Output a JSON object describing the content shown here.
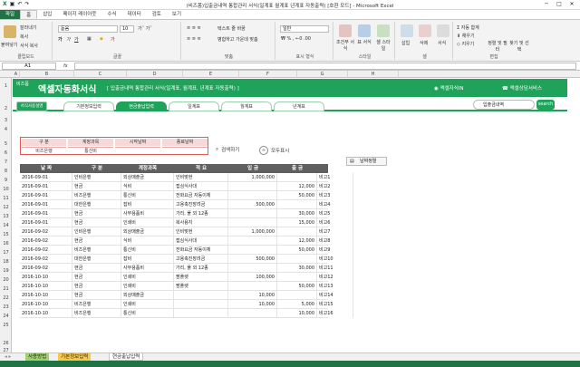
{
  "window": {
    "title": "(비즈폼)입출금내역 통합관리 서식(일계표 월계표 년계표 자동출력) [호환 모드] - Microsoft Excel",
    "controls": [
      "─",
      "□",
      "✕"
    ]
  },
  "ribbon_tabs": [
    "파일",
    "홈",
    "삽입",
    "페이지 레이아웃",
    "수식",
    "데이터",
    "검토",
    "보기"
  ],
  "ribbon": {
    "clipboard": {
      "label": "클립보드",
      "paste": "붙여넣기",
      "cut": "잘라내기",
      "copy": "복사",
      "format_painter": "서식 복사"
    },
    "font": {
      "label": "글꼴",
      "font_name": "돋움",
      "font_size": "10"
    },
    "alignment": {
      "label": "맞춤",
      "wrap": "텍스트 줄 바꿈",
      "merge": "병합하고 가운데 맞춤"
    },
    "number": {
      "label": "표시 형식",
      "format": "일반"
    },
    "styles": {
      "label": "스타일",
      "conditional": "조건부 서식",
      "table": "표 서식",
      "cell": "셀 스타일"
    },
    "cells": {
      "label": "셀",
      "insert": "삽입",
      "delete": "삭제",
      "format": "서식"
    },
    "editing": {
      "label": "편집",
      "autosum": "자동 합계",
      "fill": "채우기",
      "clear": "지우기",
      "sort": "정렬 및 필터",
      "find": "찾기 및 선택"
    }
  },
  "formula_bar": {
    "name_box": "A1",
    "fx": "fx",
    "value": ""
  },
  "columns": [
    "A",
    "B",
    "C",
    "D",
    "E",
    "F",
    "G",
    "H"
  ],
  "banner": {
    "brand": "비즈폼",
    "title": "엑셀자동화서식",
    "subtitle": "[ 입출금내역 통합관리 서식(일계표, 월계표, 년계표 자동출력) ]",
    "right1": "엑셀자식IN",
    "right2": "엑셀상담서비스"
  },
  "nav": {
    "first": "서식사용설명",
    "tabs": [
      "기본정보입력",
      "현금출납입력",
      "일계표",
      "월계표",
      "년계표"
    ],
    "selected": 1,
    "search_value": "입출금내역",
    "search_btn": "search"
  },
  "filter": {
    "headers": [
      "구 분",
      "계정과목",
      "시작날짜",
      "종료날짜"
    ],
    "values": [
      "비즈은행",
      "통신비",
      "",
      ""
    ]
  },
  "actions": {
    "search": "검색하기",
    "show_all": "모두표시",
    "sort": "날짜정렬"
  },
  "table": {
    "headers": [
      "날 짜",
      "구 분",
      "계정과목",
      "적 요",
      "입 금",
      "출 금",
      "비 고"
    ],
    "rows": [
      [
        "2016-09-01",
        "인비은행",
        "외상매출금",
        "인비맞현",
        "1,000,000",
        "",
        "비고1"
      ],
      [
        "2016-09-01",
        "현금",
        "식비",
        "접심식사대",
        "",
        "12,000",
        "비고2"
      ],
      [
        "2016-09-01",
        "비즈은행",
        "통신비",
        "전화요금 자동이체",
        "",
        "50,000",
        "비고3"
      ],
      [
        "2016-09-01",
        "대한은행",
        "잡비",
        "고용축진장려금",
        "500,000",
        "",
        "비고4"
      ],
      [
        "2016-09-01",
        "현금",
        "사무용품비",
        "가리, 풀 외 12종",
        "",
        "30,000",
        "비고5"
      ],
      [
        "2016-09-01",
        "현금",
        "인쇄비",
        "복사용지",
        "",
        "15,000",
        "비고6"
      ],
      [
        "2016-09-02",
        "인비은행",
        "외상매출금",
        "인비맞현",
        "1,000,000",
        "",
        "비고7"
      ],
      [
        "2016-09-02",
        "현금",
        "식비",
        "접심식사대",
        "",
        "12,000",
        "비고8"
      ],
      [
        "2016-09-02",
        "비즈은행",
        "통신비",
        "전화요금 자동이체",
        "",
        "50,000",
        "비고9"
      ],
      [
        "2016-09-02",
        "대한은행",
        "잡비",
        "고용축진장려금",
        "500,000",
        "",
        "비고10"
      ],
      [
        "2016-09-02",
        "현금",
        "사무용품비",
        "가리, 풀 외 12종",
        "",
        "30,000",
        "비고11"
      ],
      [
        "2016-10-10",
        "현금",
        "인쇄비",
        "팜플렛",
        "100,000",
        "",
        "비고12"
      ],
      [
        "2016-10-10",
        "현금",
        "인쇄비",
        "팜플렛",
        "",
        "50,000",
        "비고13"
      ],
      [
        "2016-10-10",
        "현금",
        "외상매출금",
        "",
        "10,000",
        "",
        "비고14"
      ],
      [
        "2016-10-10",
        "비즈은행",
        "인쇄비",
        "",
        "10,000",
        "5,000",
        "비고15"
      ],
      [
        "2016-10-10",
        "비즈은행",
        "통신비",
        "",
        "",
        "10,000",
        "비고16"
      ]
    ]
  },
  "sheet_tabs": [
    "사용방법",
    "기본정보입력",
    "현금출납입력"
  ],
  "colors": {
    "accent": "#1fa25a",
    "excel": "#217346",
    "header": "#5f5f5f"
  }
}
